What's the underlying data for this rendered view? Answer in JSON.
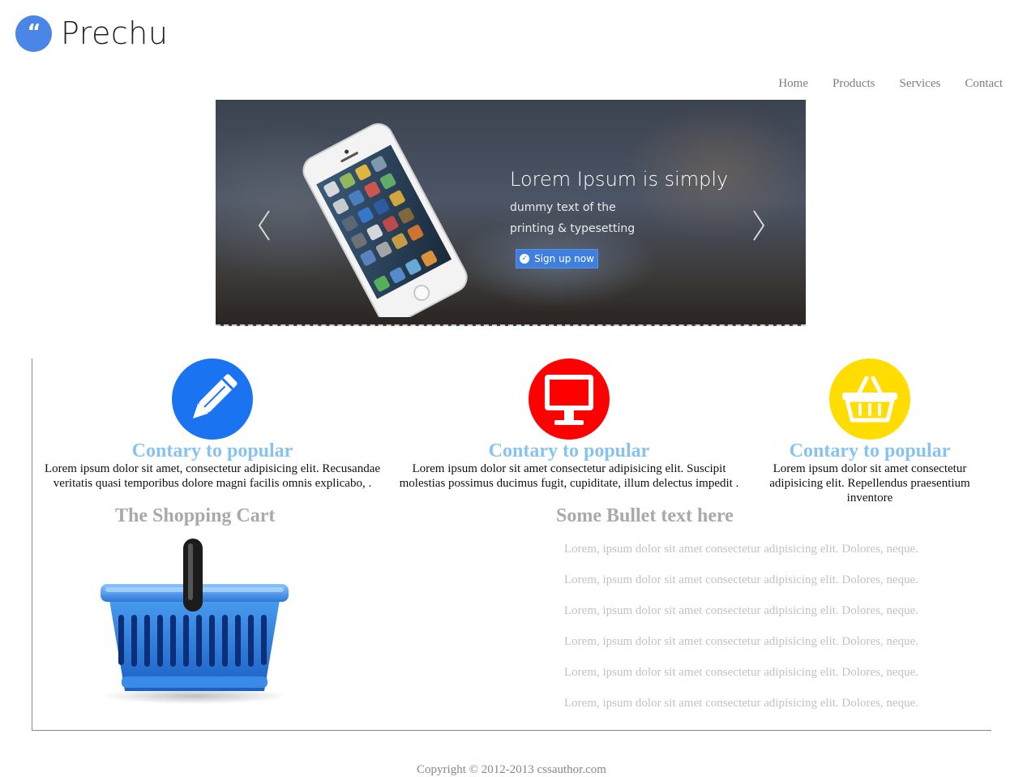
{
  "brand": {
    "name": "Prechu",
    "badge_glyph": "“",
    "badge_color": "#4a86e8"
  },
  "nav": {
    "items": [
      "Home",
      "Products",
      "Services",
      "Contact"
    ]
  },
  "slider": {
    "title": "Lorem Ipsum is simply",
    "subtitle_line1": "dummy text of the",
    "subtitle_line2": "printing & typesetting",
    "button_label": "Sign up now",
    "prev_icon": "chevron-left-icon",
    "next_icon": "chevron-right-icon"
  },
  "features": [
    {
      "icon": "pencil-icon",
      "color": "#1a73f0",
      "title": "Contary to popular",
      "text": "Lorem ipsum dolor sit amet, consectetur adipisicing elit. Recusandae veritatis quasi temporibus dolore magni facilis omnis explicabo, ."
    },
    {
      "icon": "monitor-icon",
      "color": "#ff0000",
      "title": "Contary to popular",
      "text": "Lorem ipsum dolor sit amet consectetur adipisicing elit. Suscipit molestias possimus ducimus fugit, cupiditate, illum delectus impedit ."
    },
    {
      "icon": "basket-icon",
      "color": "#ffdd00",
      "title": "Contary to popular",
      "text": "Lorem ipsum dolor sit amet consectetur adipisicing elit. Repellendus praesentium inventore"
    }
  ],
  "cart": {
    "title": "The Shopping Cart",
    "image": "shopping-basket-icon"
  },
  "bullets": {
    "title": "Some Bullet text here",
    "items": [
      "Lorem, ipsum dolor sit amet consectetur adipisicing elit. Dolores, neque.",
      "Lorem, ipsum dolor sit amet consectetur adipisicing elit. Dolores, neque.",
      "Lorem, ipsum dolor sit amet consectetur adipisicing elit. Dolores, neque.",
      "Lorem, ipsum dolor sit amet consectetur adipisicing elit. Dolores, neque.",
      "Lorem, ipsum dolor sit amet consectetur adipisicing elit. Dolores, neque.",
      "Lorem, ipsum dolor sit amet consectetur adipisicing elit. Dolores, neque."
    ]
  },
  "footer": {
    "copyright": "Copyright © 2012-2013 cssauthor.com"
  }
}
